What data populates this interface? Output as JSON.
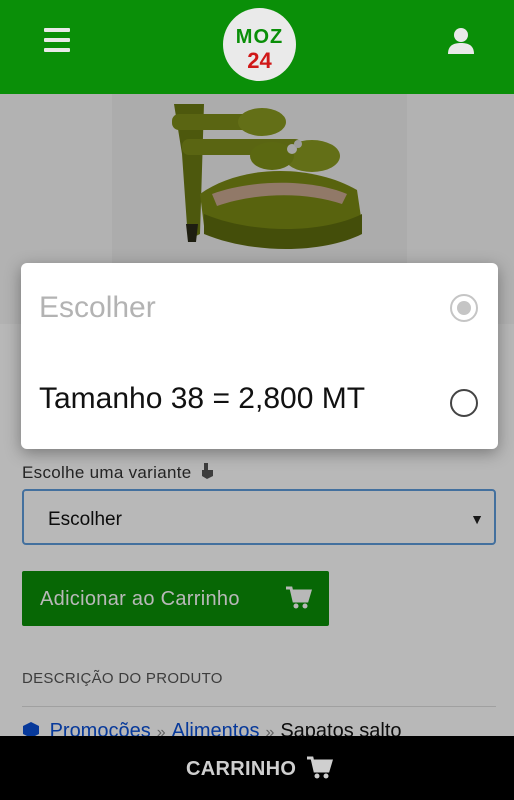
{
  "header": {
    "logo_top": "MOZ",
    "logo_bottom": "24",
    "brand_green": "#0a8f08",
    "brand_red": "#d01818"
  },
  "icons": {
    "menu": "hamburger-menu-icon",
    "user": "user-icon",
    "cart": "shopping-cart-icon",
    "hand": "pointing-hand-icon"
  },
  "product": {
    "variant_label": "Escolhe uma variante",
    "select_value": "Escolher",
    "add_to_cart_label": "Adicionar ao Carrinho",
    "description_title": "DESCRIÇÃO DO PRODUTO",
    "breadcrumb": [
      "Promoções",
      "Alimentos",
      "Sapatos salto"
    ]
  },
  "dialog": {
    "options": [
      {
        "label": "Escolher",
        "selected": true,
        "disabled": true
      },
      {
        "label": "Tamanho 38 = 2,800 MT",
        "selected": false,
        "disabled": false
      }
    ]
  },
  "bottom_bar": {
    "cart_label": "CARRINHO"
  }
}
